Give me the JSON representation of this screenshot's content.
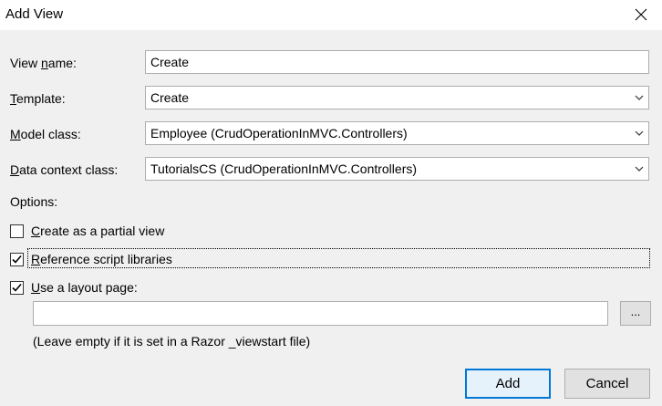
{
  "window": {
    "title": "Add View"
  },
  "form": {
    "view_name": {
      "label_pre": "View ",
      "label_key": "n",
      "label_post": "ame:",
      "value": "Create"
    },
    "template": {
      "label_pre": "",
      "label_key": "T",
      "label_post": "emplate:",
      "value": "Create"
    },
    "model_class": {
      "label_pre": "",
      "label_key": "M",
      "label_post": "odel class:",
      "value": "Employee (CrudOperationInMVC.Controllers)"
    },
    "data_context_class": {
      "label_pre": "",
      "label_key": "D",
      "label_post": "ata context class:",
      "value": "TutorialsCS (CrudOperationInMVC.Controllers)"
    }
  },
  "options": {
    "heading": "Options:",
    "partial_view": {
      "label_key": "C",
      "label_post": "reate as a partial view",
      "checked": false
    },
    "reference_scripts": {
      "label_key": "R",
      "label_post": "eference script libraries",
      "checked": true
    },
    "layout_page": {
      "label_key": "U",
      "label_post": "se a layout page:",
      "checked": true,
      "path_value": "",
      "browse_label": "...",
      "hint": "(Leave empty if it is set in a Razor _viewstart file)"
    }
  },
  "buttons": {
    "add_label": "Add",
    "cancel_label": "Cancel"
  },
  "colors": {
    "default_button_border": "#0078d7",
    "dialog_background": "#f0f0f0"
  }
}
